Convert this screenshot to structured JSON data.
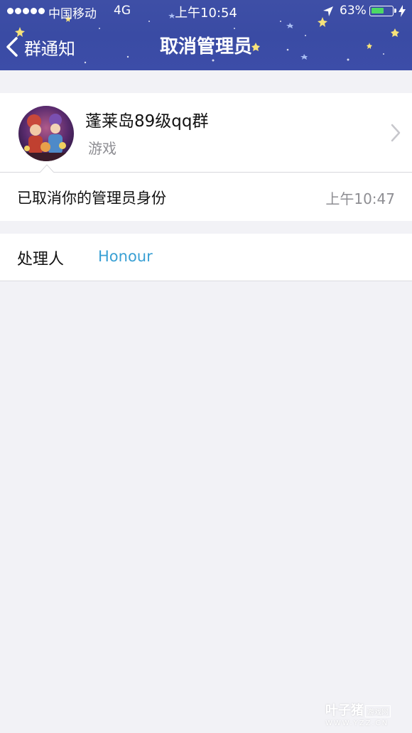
{
  "status_bar": {
    "carrier": "中国移动",
    "network": "4G",
    "time": "上午10:54",
    "battery_percent": "63%",
    "battery_level": 0.63
  },
  "nav": {
    "back_label": "群通知",
    "title": "取消管理员"
  },
  "group": {
    "name": "蓬莱岛89级qq群",
    "category": "游戏"
  },
  "notice": {
    "text": "已取消你的管理员身份",
    "time": "上午10:47"
  },
  "handler": {
    "label": "处理人",
    "name": "Honour"
  },
  "watermark": {
    "brand": "叶子猪",
    "tag": "游戏网",
    "url": "WWW.YZZ.CN"
  },
  "colors": {
    "header": "#3e4fa6",
    "link": "#3aa0d4",
    "background": "#f2f2f6",
    "battery": "#4cd964"
  }
}
